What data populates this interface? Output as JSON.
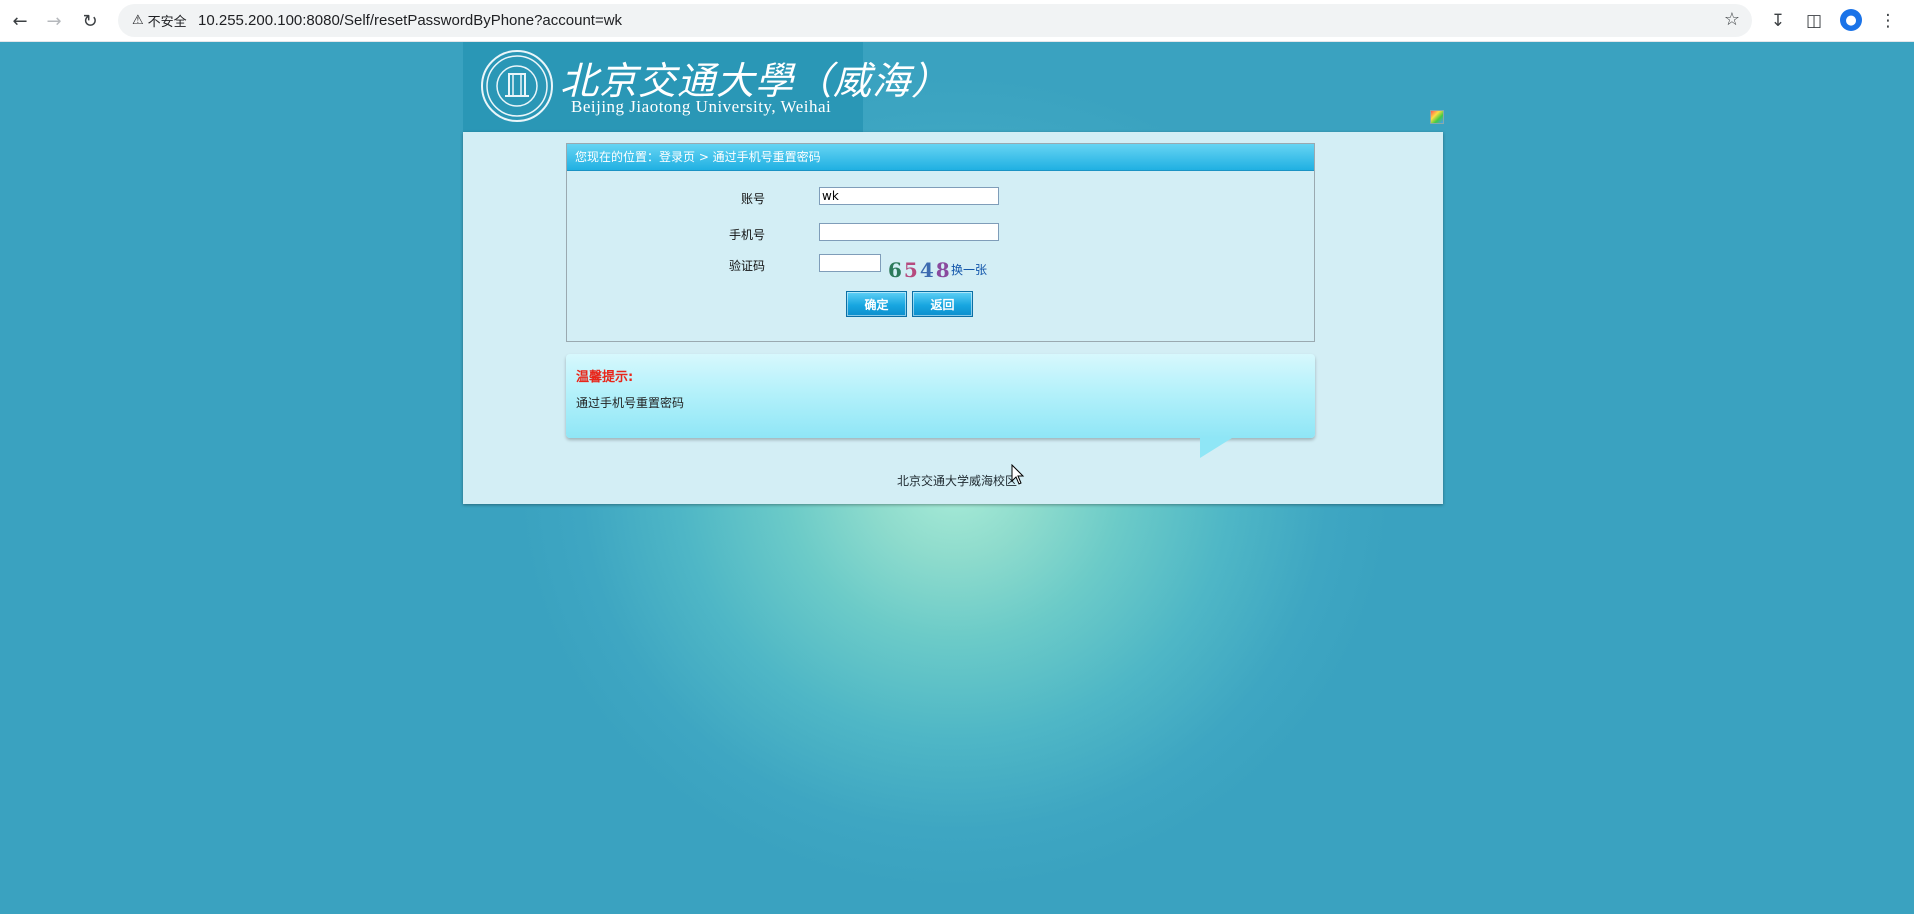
{
  "browser": {
    "security_label": "不安全",
    "url": "10.255.200.100:8080/Self/resetPasswordByPhone?account=wk",
    "icons": {
      "back": "arrow-left-icon",
      "forward": "arrow-right-icon",
      "reload": "reload-icon",
      "bookmark": "star-icon",
      "download": "download-icon",
      "sidepanel": "side-panel-icon",
      "profile": "profile-icon",
      "menu": "kebab-menu-icon"
    }
  },
  "header": {
    "logo_cn": "北京交通大學（威海）",
    "logo_en": "Beijing Jiaotong University, Weihai"
  },
  "breadcrumb": {
    "text": "您现在的位置：登录页 > 通过手机号重置密码"
  },
  "form": {
    "account_label": "账号",
    "account_value": "wk",
    "phone_label": "手机号",
    "phone_value": "",
    "captcha_label": "验证码",
    "captcha_value": "",
    "captcha_chars": [
      "6",
      "5",
      "4",
      "8"
    ],
    "refresh_label": "换一张",
    "confirm_label": "确定",
    "back_label": "返回"
  },
  "tip": {
    "title": "温馨提示:",
    "text": "通过手机号重置密码"
  },
  "footer": {
    "text": "北京交通大学威海校区"
  },
  "colors": {
    "page_background": "#3aa2c0",
    "glow": "#a9ecd8",
    "panel": "#d3eef5",
    "crumb_bar": "#20b0e2",
    "tip_title": "#e8261a",
    "button": "#18a6e0"
  }
}
